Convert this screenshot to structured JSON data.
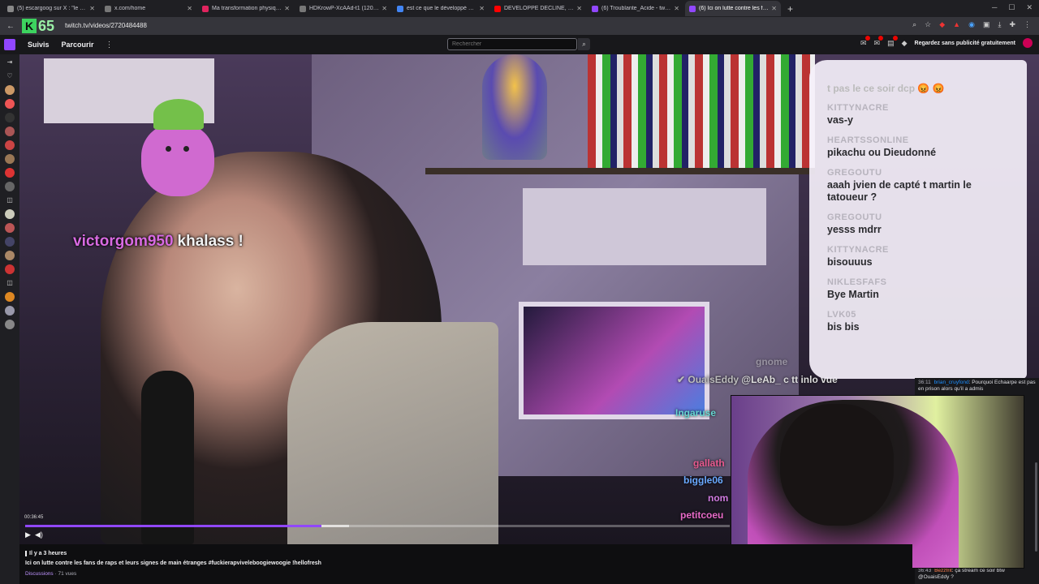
{
  "browser": {
    "tabs": [
      {
        "label": "(5) escargoog sur X : \"le suis p",
        "fav": "#888888"
      },
      {
        "label": "x.com/home",
        "fav": "#777777"
      },
      {
        "label": "Ma transformation physique ap",
        "fav": "#e0245e"
      },
      {
        "label": "HDKrowP-XcAAd-t1 (1206×17",
        "fav": "#777777"
      },
      {
        "label": "est ce que le développé décline",
        "fav": "#4285f4"
      },
      {
        "label": "DÉVELOPPÉ DÉCLINÉ, Mieux q",
        "fav": "#ff0000"
      },
      {
        "label": "(6) Troublante_Acide - twitch",
        "fav": "#9147ff"
      },
      {
        "label": "(6) Ici on lutte contre les fans d",
        "fav": "#9147ff"
      }
    ],
    "new_tab": "+",
    "url": "twitch.tv/videos/2720484488",
    "logo_letter": "K",
    "logo_number": "65"
  },
  "twitch_nav": {
    "following": "Suivis",
    "browse": "Parcourir",
    "more": "⋮",
    "search_placeholder": "Rechercher",
    "ad_free": "Regardez sans publicité gratuitement"
  },
  "overlay": {
    "username": "victorgom950",
    "message": "khalass !"
  },
  "on_stream_text": {
    "line1": "OuaisEddy",
    "line1_rest": "@LeAb_ c tt inlo vue",
    "line2": "Ingaruse",
    "line3": "gnome",
    "names": [
      "gallath",
      "biggle06",
      "nom",
      "petitcoeu"
    ]
  },
  "chat_overlay": {
    "faded": "t pas le ce soir dcp 😡 😡",
    "messages": [
      {
        "user": "KITTYNACRE",
        "text": "vas-y"
      },
      {
        "user": "HEARTSSONLINE",
        "text": "pikachu ou Dieudonné"
      },
      {
        "user": "GREGOUTU",
        "text": "aaah jvien de capté t martin le tatoueur ?"
      },
      {
        "user": "GREGOUTU",
        "text": "yesss mdrr"
      },
      {
        "user": "KITTYNACRE",
        "text": "bisouuus"
      },
      {
        "user": "NIKLESFAFS",
        "text": "Bye Martin"
      },
      {
        "user": "LVK05",
        "text": "bis bis"
      }
    ]
  },
  "player": {
    "timecode": "00:36:45",
    "progress": 0.42,
    "buffered": 0.46
  },
  "video_info": {
    "ago": "Il y a 3 heures",
    "title": "Ici on lutte contre les fans de raps et leurs signes de main étranges #fuckierapviveleboogiewoogie !hellofresh",
    "category": "Discussions",
    "views": "· 71 vues"
  },
  "chat_replay": [
    {
      "time": "36:11",
      "user": "brian_cruyfond",
      "text": ": Pourquoi Echaarpe est pas en prison alors qu'il a admis"
    },
    {
      "time": "36:43",
      "user": "Bezzfrit",
      "text": ": ça stream ce soir btw @OuaisEddy ?"
    }
  ],
  "colors": {
    "twitch_purple": "#9147ff",
    "overlay_user": "#d86ae2"
  }
}
